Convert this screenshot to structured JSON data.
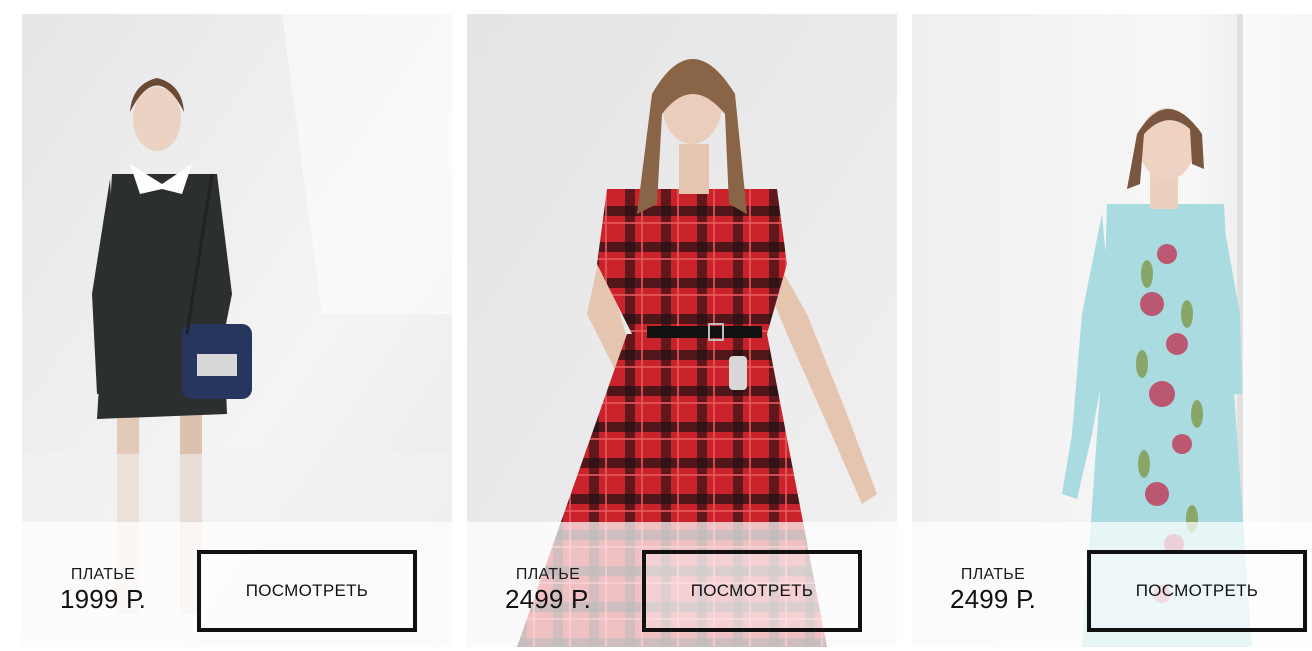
{
  "products": [
    {
      "name": "ПЛАТЬЕ",
      "price": "1999 Р.",
      "button": "ПОСМОТРЕТЬ",
      "photo": "black-dress-with-white-collar",
      "dress_color": "#2b2f2e"
    },
    {
      "name": "ПЛАТЬЕ",
      "price": "2499 Р.",
      "button": "ПОСМОТРЕТЬ",
      "photo": "red-plaid-dress",
      "dress_color": "#c9222a"
    },
    {
      "name": "ПЛАТЬЕ",
      "price": "2499 Р.",
      "button": "ПОСМОТРЕТЬ",
      "photo": "mint-floral-embroidered-dress",
      "dress_color": "#a9dbe0"
    }
  ]
}
